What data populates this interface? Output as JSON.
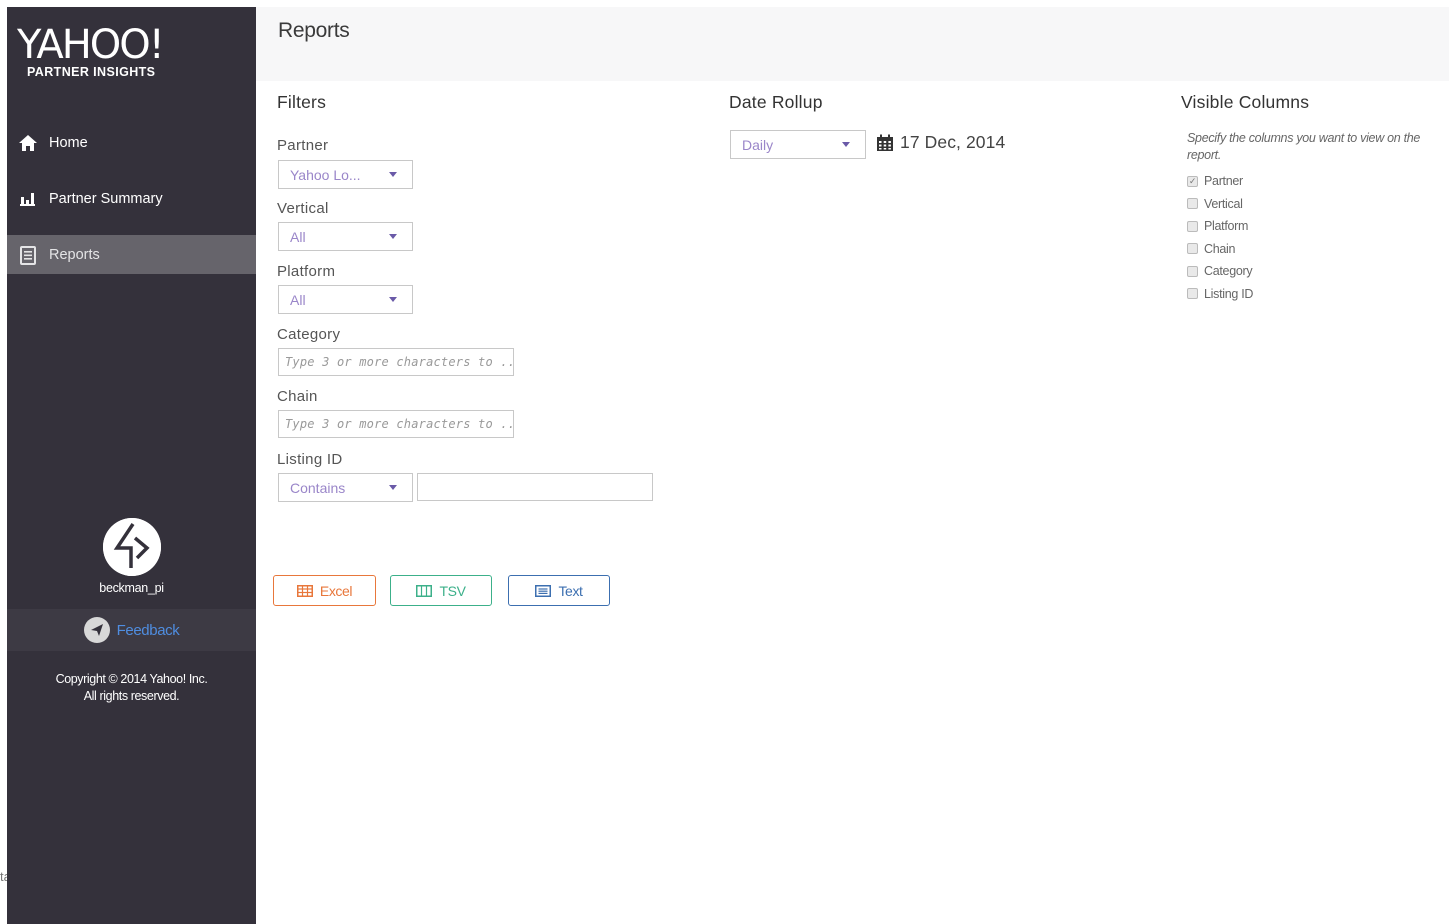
{
  "app": {
    "logo_text": "YAHOO!",
    "logo_sub": "PARTNER INSIGHTS"
  },
  "sidebar": {
    "items": [
      {
        "label": "Home",
        "icon": "home-icon",
        "active": false
      },
      {
        "label": "Partner Summary",
        "icon": "bar-chart-icon",
        "active": false
      },
      {
        "label": "Reports",
        "icon": "document-icon",
        "active": true
      }
    ],
    "user": {
      "name": "beckman_pi"
    },
    "feedback_label": "Feedback",
    "copyright_line1": "Copyright © 2014 Yahoo! Inc.",
    "copyright_line2": "All rights reserved."
  },
  "header": {
    "title": "Reports"
  },
  "filters": {
    "title": "Filters",
    "partner": {
      "label": "Partner",
      "value": "Yahoo Lo..."
    },
    "vertical": {
      "label": "Vertical",
      "value": "All"
    },
    "platform": {
      "label": "Platform",
      "value": "All"
    },
    "category": {
      "label": "Category",
      "placeholder": "Type 3 or more characters to ..."
    },
    "chain": {
      "label": "Chain",
      "placeholder": "Type 3 or more characters to ..."
    },
    "listing_id": {
      "label": "Listing ID",
      "operator": "Contains",
      "value": ""
    }
  },
  "date_rollup": {
    "title": "Date Rollup",
    "value": "Daily",
    "date": "17 Dec, 2014"
  },
  "visible_columns": {
    "title": "Visible Columns",
    "description": "Specify the columns you want to view on the report.",
    "items": [
      {
        "label": "Partner",
        "checked": true
      },
      {
        "label": "Vertical",
        "checked": false
      },
      {
        "label": "Platform",
        "checked": false
      },
      {
        "label": "Chain",
        "checked": false
      },
      {
        "label": "Category",
        "checked": false
      },
      {
        "label": "Listing ID",
        "checked": false
      }
    ]
  },
  "export": {
    "excel_label": "Excel",
    "tsv_label": "TSV",
    "text_label": "Text"
  },
  "colors": {
    "sidebar_bg": "#34313b",
    "sidebar_active": "#66646b",
    "excel": "#e8773b",
    "tsv": "#3cb08a",
    "text": "#3c6fb0",
    "select_text": "#9a86c9",
    "feedback": "#4f8de0"
  },
  "stray_text": "ta"
}
